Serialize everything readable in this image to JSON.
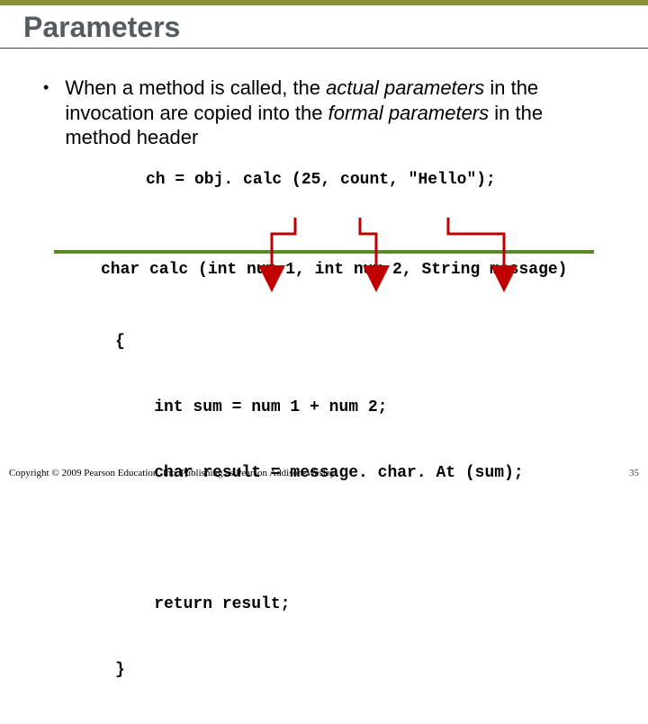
{
  "title": "Parameters",
  "bullet": {
    "pre": "When a method is called, the ",
    "em1": "actual parameters",
    "mid": " in the invocation are copied into the ",
    "em2": "formal parameters",
    "post": " in the method header"
  },
  "code": {
    "call": "ch = obj. calc (25, count, \"Hello\");",
    "signature": "char calc (int num 1, int num 2, String message)",
    "line_open": "{",
    "line1": "    int sum = num 1 + num 2;",
    "line2": "    char result = message. char. At (sum);",
    "blank": " ",
    "line3": "    return result;",
    "line_close": "}"
  },
  "arrows": {
    "color": "#c00000",
    "rule_color": "#5b8a2a"
  },
  "footer": {
    "copyright": "Copyright © 2009 Pearson Education, Inc. Publishing as Pearson Addison-Wesley",
    "page": "35"
  }
}
